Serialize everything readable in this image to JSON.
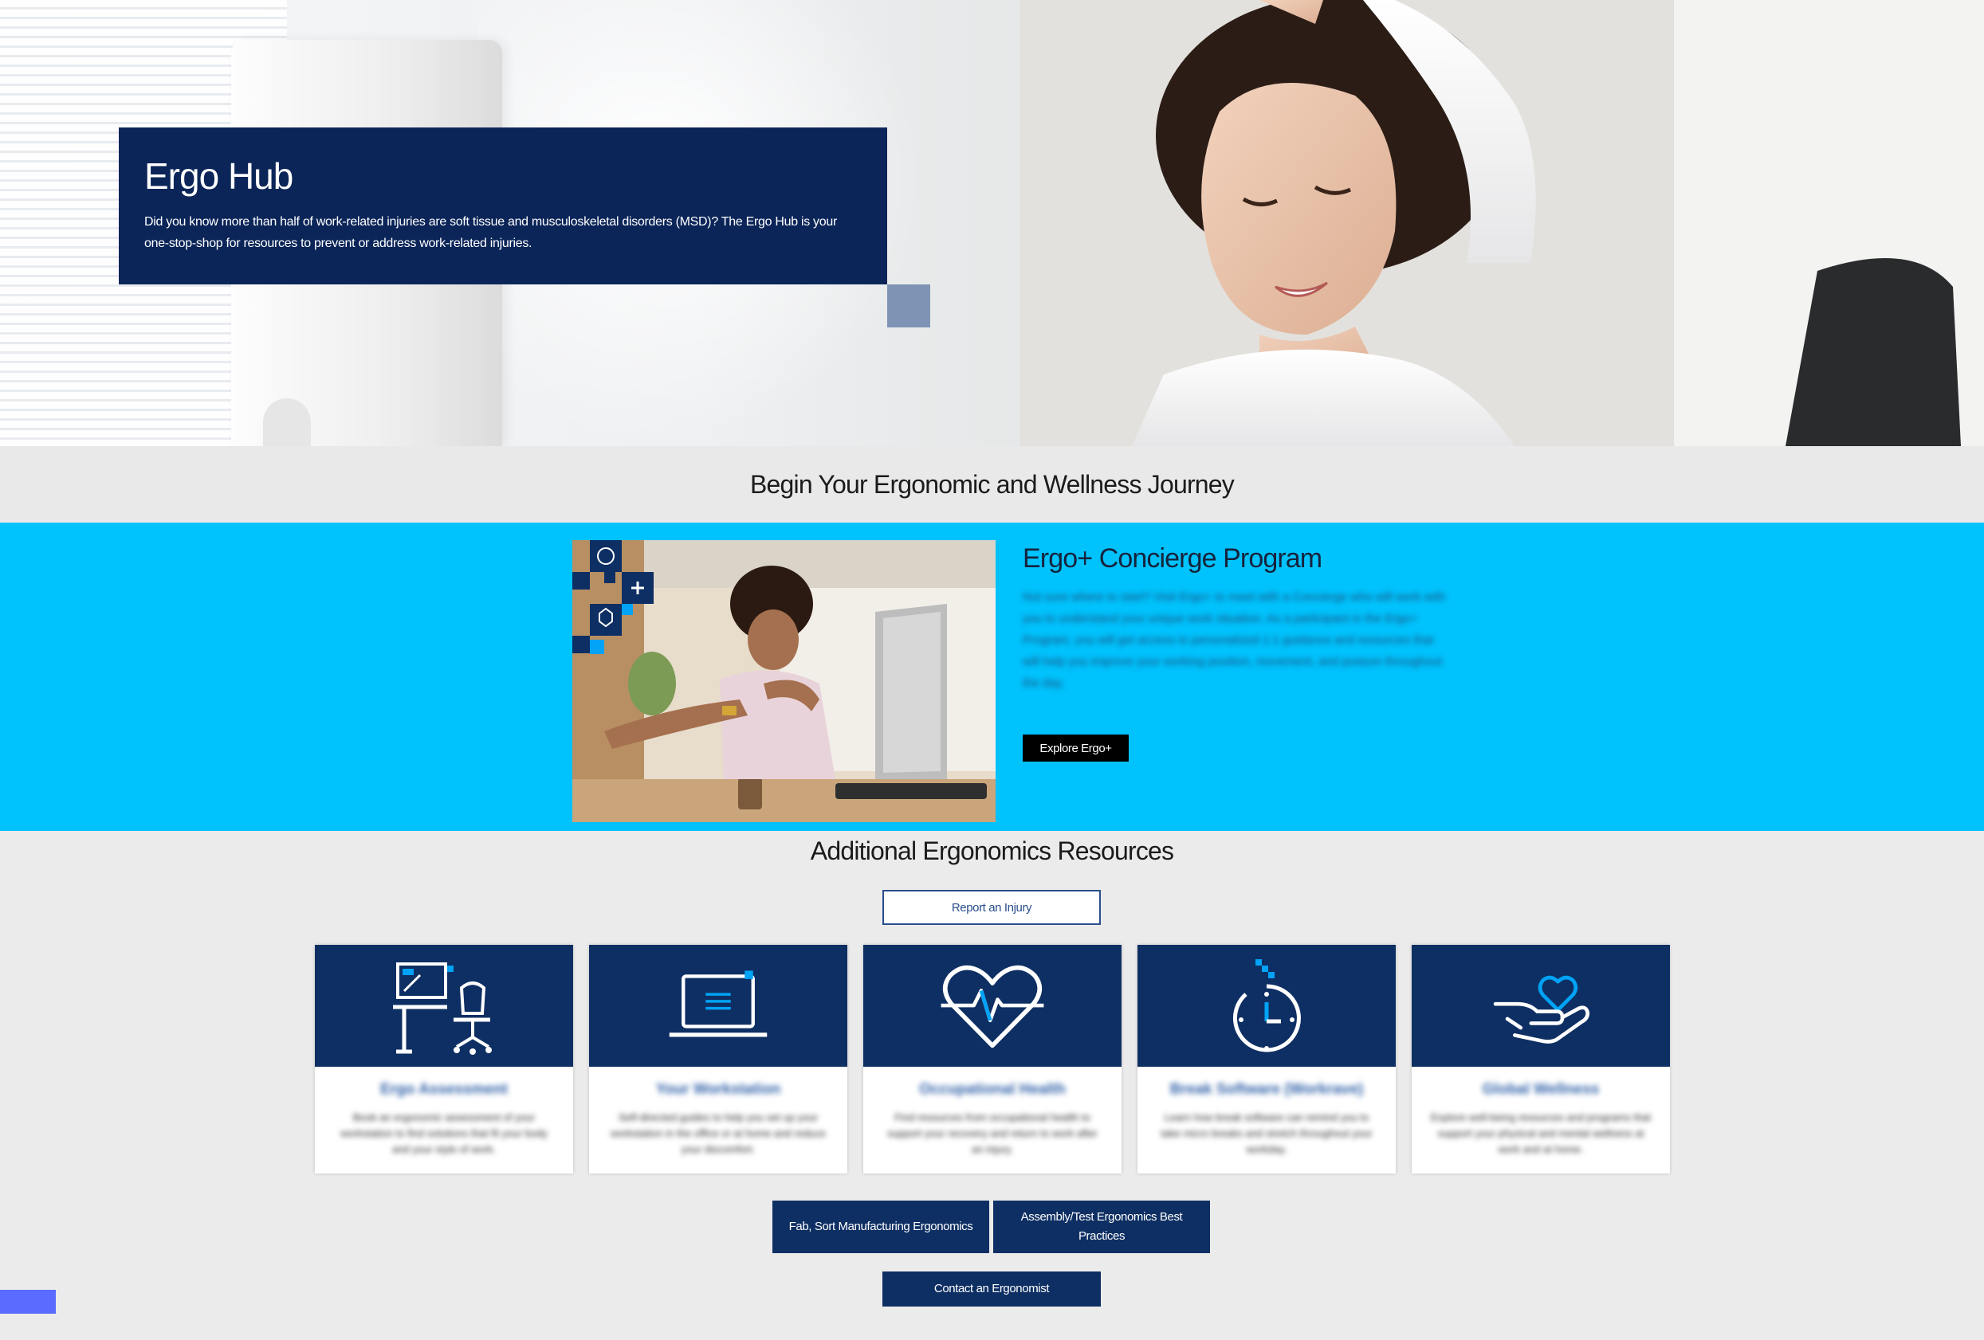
{
  "hero": {
    "title": "Ergo Hub",
    "description": "Did you know more than half of work-related injuries are soft tissue and musculoskeletal disorders (MSD)? The Ergo Hub is your one-stop-shop for resources to prevent or address work-related injuries."
  },
  "journey": {
    "heading": "Begin Your Ergonomic and Wellness Journey"
  },
  "concierge": {
    "title": "Ergo+ Concierge Program",
    "body": "Not sure where to start? Visit Ergo+ to meet with a Concierge who will work with you to understand your unique work situation. As a participant in the Ergo+ Program, you will get access to personalized 1:1 guidance and resources that will help you improve your working position, movement, and posture throughout the day.",
    "button_label": "Explore Ergo+"
  },
  "resources": {
    "heading": "Additional Ergonomics Resources",
    "report_button": "Report an Injury",
    "cards": [
      {
        "title": "Ergo Assessment",
        "description": "Book an ergonomic assessment of your workstation to find solutions that fit your body and your style of work.",
        "icon": "workstation-icon"
      },
      {
        "title": "Your Workstation",
        "description": "Self-directed guides to help you set up your workstation in the office or at home and reduce your discomfort.",
        "icon": "laptop-icon"
      },
      {
        "title": "Occupational Health",
        "description": "Find resources from occupational health to support your recovery and return to work after an injury.",
        "icon": "heartbeat-icon"
      },
      {
        "title": "Break Software (Workrave)",
        "description": "Learn how break software can remind you to take micro breaks and stretch throughout your workday.",
        "icon": "stopwatch-icon"
      },
      {
        "title": "Global Wellness",
        "description": "Explore well-being resources and programs that support your physical and mental wellness at work and at home.",
        "icon": "hand-heart-icon"
      }
    ],
    "fab_button": "Fab, Sort Manufacturing Ergonomics",
    "assembly_button": "Assembly/Test Ergonomics Best Practices",
    "contact_button": "Contact an Ergonomist"
  },
  "colors": {
    "navy": "#0b2558",
    "card_navy": "#0e2f63",
    "cyan_band": "#00c2fc",
    "page_bg": "#ebebeb",
    "accent_square": "#7f93b4",
    "icon_blue": "#00a3f6",
    "feedback_tab": "#5b6bff"
  }
}
